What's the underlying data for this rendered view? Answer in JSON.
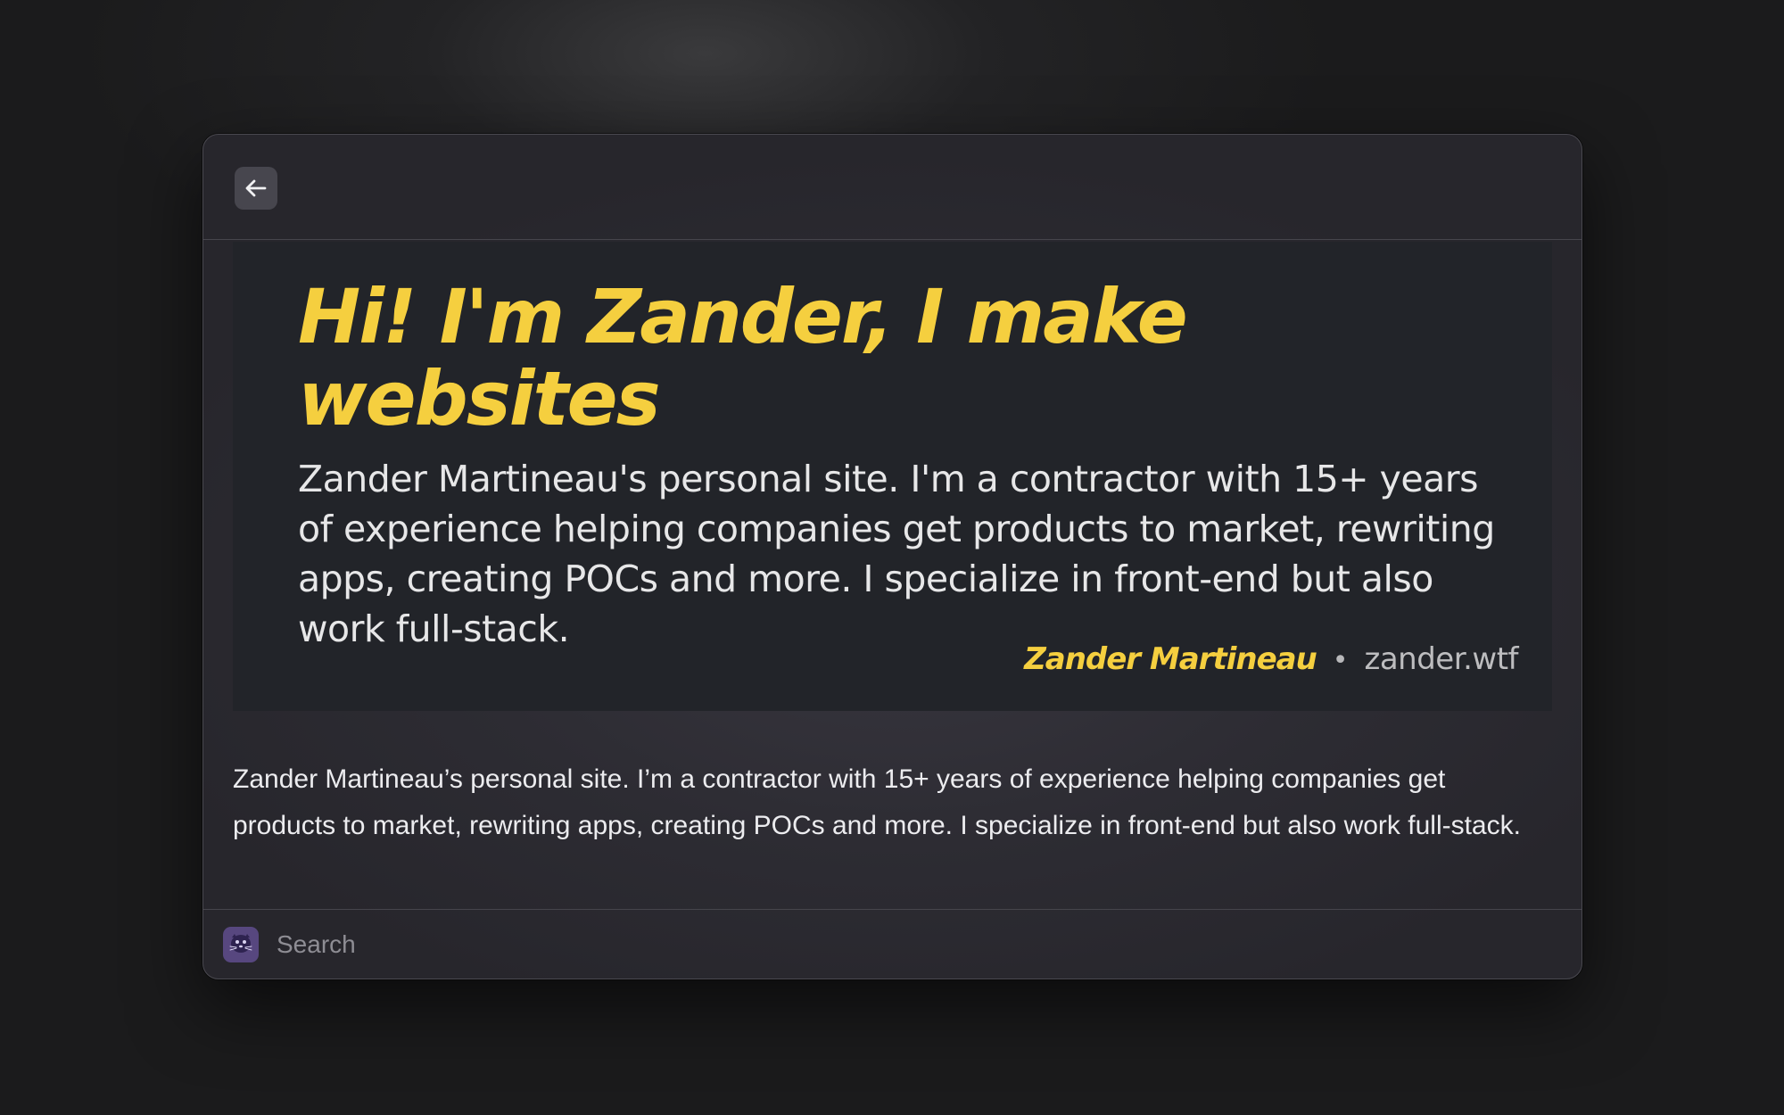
{
  "window": {
    "back_icon": "arrow-left-icon",
    "app_icon": "seal-icon",
    "accent_color": "#f5cf3f"
  },
  "preview": {
    "title": "Hi! I'm Zander, I make websites",
    "description": "Zander Martineau's personal site. I'm a contractor with 15+ years of experience helping companies get products to market, rewriting apps, creating POCs and more. I specialize in front-end but also work full-stack.",
    "name": "Zander Martineau",
    "separator": "•",
    "domain": "zander.wtf"
  },
  "description": "Zander Martineau’s personal site. I’m a contractor with 15+ years of experience helping companies get products to market, rewriting apps, creating POCs and more. I specialize in front-end but also work full-stack.",
  "search": {
    "placeholder": "Search",
    "value": ""
  }
}
